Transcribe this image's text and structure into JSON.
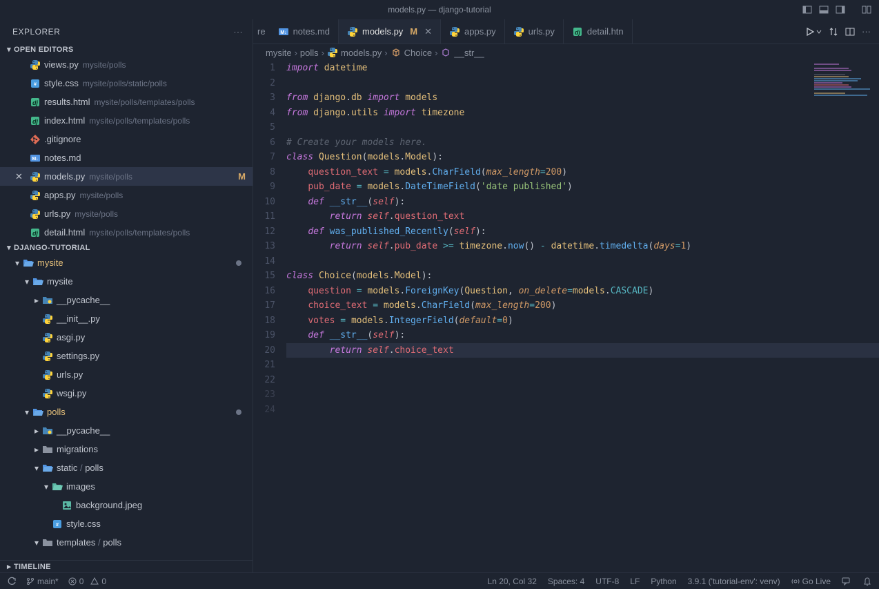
{
  "titlebar": {
    "title": "models.py — django-tutorial"
  },
  "explorer": {
    "title": "EXPLORER",
    "sections": {
      "open_editors": "OPEN EDITORS",
      "project": "DJANGO-TUTORIAL",
      "timeline": "TIMELINE"
    }
  },
  "open_editors": [
    {
      "name": "views.py",
      "desc": "mysite/polls",
      "icon": "py"
    },
    {
      "name": "style.css",
      "desc": "mysite/polls/static/polls",
      "icon": "css"
    },
    {
      "name": "results.html",
      "desc": "mysite/polls/templates/polls",
      "icon": "dj"
    },
    {
      "name": "index.html",
      "desc": "mysite/polls/templates/polls",
      "icon": "dj"
    },
    {
      "name": ".gitignore",
      "desc": "",
      "icon": "git"
    },
    {
      "name": "notes.md",
      "desc": "",
      "icon": "md"
    },
    {
      "name": "models.py",
      "desc": "mysite/polls",
      "icon": "py",
      "active": true,
      "modified": "M"
    },
    {
      "name": "apps.py",
      "desc": "mysite/polls",
      "icon": "py"
    },
    {
      "name": "urls.py",
      "desc": "mysite/polls",
      "icon": "py"
    },
    {
      "name": "detail.html",
      "desc": "mysite/polls/templates/polls",
      "icon": "dj"
    }
  ],
  "tree": [
    {
      "depth": 0,
      "chev": "down",
      "icon": "folder-open",
      "label": "mysite",
      "dirty": true,
      "gold": true
    },
    {
      "depth": 1,
      "chev": "down",
      "icon": "folder-open",
      "label": "mysite"
    },
    {
      "depth": 2,
      "chev": "right",
      "icon": "folder-py",
      "label": "__pycache__"
    },
    {
      "depth": 2,
      "icon": "py",
      "label": "__init__.py"
    },
    {
      "depth": 2,
      "icon": "py",
      "label": "asgi.py"
    },
    {
      "depth": 2,
      "icon": "py",
      "label": "settings.py"
    },
    {
      "depth": 2,
      "icon": "py",
      "label": "urls.py"
    },
    {
      "depth": 2,
      "icon": "py",
      "label": "wsgi.py"
    },
    {
      "depth": 1,
      "chev": "down",
      "icon": "folder-open",
      "label": "polls",
      "dirty": true,
      "gold": true
    },
    {
      "depth": 2,
      "chev": "right",
      "icon": "folder-py",
      "label": "__pycache__"
    },
    {
      "depth": 2,
      "chev": "right",
      "icon": "folder",
      "label": "migrations"
    },
    {
      "depth": 2,
      "chev": "down",
      "icon": "folder-open",
      "label": "static",
      "slash": "polls"
    },
    {
      "depth": 3,
      "chev": "down",
      "icon": "folder-img",
      "label": "images"
    },
    {
      "depth": 4,
      "icon": "img",
      "label": "background.jpeg"
    },
    {
      "depth": 3,
      "icon": "css",
      "label": "style.css"
    },
    {
      "depth": 2,
      "chev": "down",
      "icon": "folder",
      "label": "templates",
      "slash": "polls"
    }
  ],
  "tabs": [
    {
      "frag": "re"
    },
    {
      "icon": "md",
      "label": "notes.md"
    },
    {
      "icon": "py",
      "label": "models.py",
      "modified": "M",
      "active": true,
      "close": true
    },
    {
      "icon": "py",
      "label": "apps.py"
    },
    {
      "icon": "py",
      "label": "urls.py"
    },
    {
      "icon": "dj",
      "label": "detail.htn"
    }
  ],
  "breadcrumb": [
    {
      "label": "mysite"
    },
    {
      "label": "polls"
    },
    {
      "icon": "py",
      "label": "models.py"
    },
    {
      "icon": "class",
      "label": "Choice"
    },
    {
      "icon": "method",
      "label": "__str__"
    }
  ],
  "code": {
    "lines": 24,
    "active_line": 20
  },
  "statusbar": {
    "branch": "main*",
    "errors": "0",
    "warnings": "0",
    "position": "Ln 20, Col 32",
    "spaces": "Spaces: 4",
    "encoding": "UTF-8",
    "eol": "LF",
    "language": "Python",
    "env": "3.9.1 ('tutorial-env': venv)",
    "golive": "Go Live"
  }
}
